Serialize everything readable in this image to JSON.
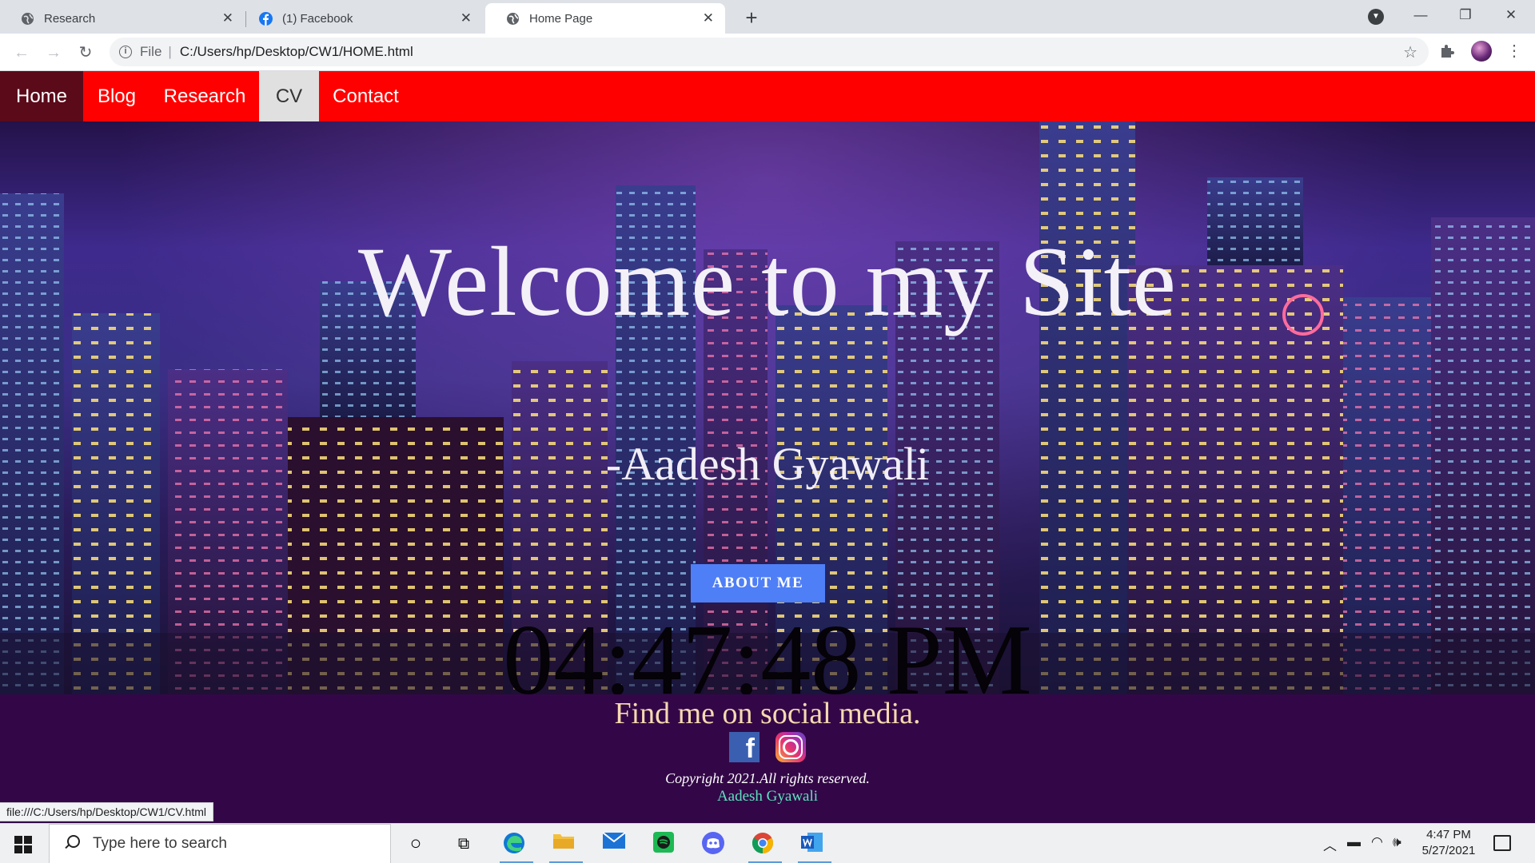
{
  "browser": {
    "tabs": [
      {
        "title": "Research",
        "active": false
      },
      {
        "title": "(1) Facebook",
        "active": false
      },
      {
        "title": "Home Page",
        "active": true
      }
    ],
    "omnibox": {
      "scheme": "File",
      "url": "C:/Users/hp/Desktop/CW1/HOME.html"
    },
    "status_url": "file:///C:/Users/hp/Desktop/CW1/CV.html"
  },
  "site": {
    "nav": [
      "Home",
      "Blog",
      "Research",
      "CV",
      "Contact"
    ],
    "hero_title": "Welcome to my Site",
    "author": "-Aadesh Gyawali",
    "about_button": "ABOUT ME",
    "clock": "04:47:48 PM",
    "footer": {
      "find_me": "Find me on social media.",
      "copyright": "Copyright 2021.All rights reserved.",
      "name": "Aadesh Gyawali"
    },
    "colors": {
      "nav_bg": "#ff0000",
      "footer_bg": "#330747",
      "button": "#4f7ff6"
    }
  },
  "taskbar": {
    "search_placeholder": "Type here to search",
    "time": "4:47 PM",
    "date": "5/27/2021",
    "apps": [
      "cortana-icon",
      "task-view-icon",
      "edge-icon",
      "file-explorer-icon",
      "mail-icon",
      "spotify-icon",
      "discord-icon",
      "chrome-icon",
      "word-icon"
    ]
  }
}
